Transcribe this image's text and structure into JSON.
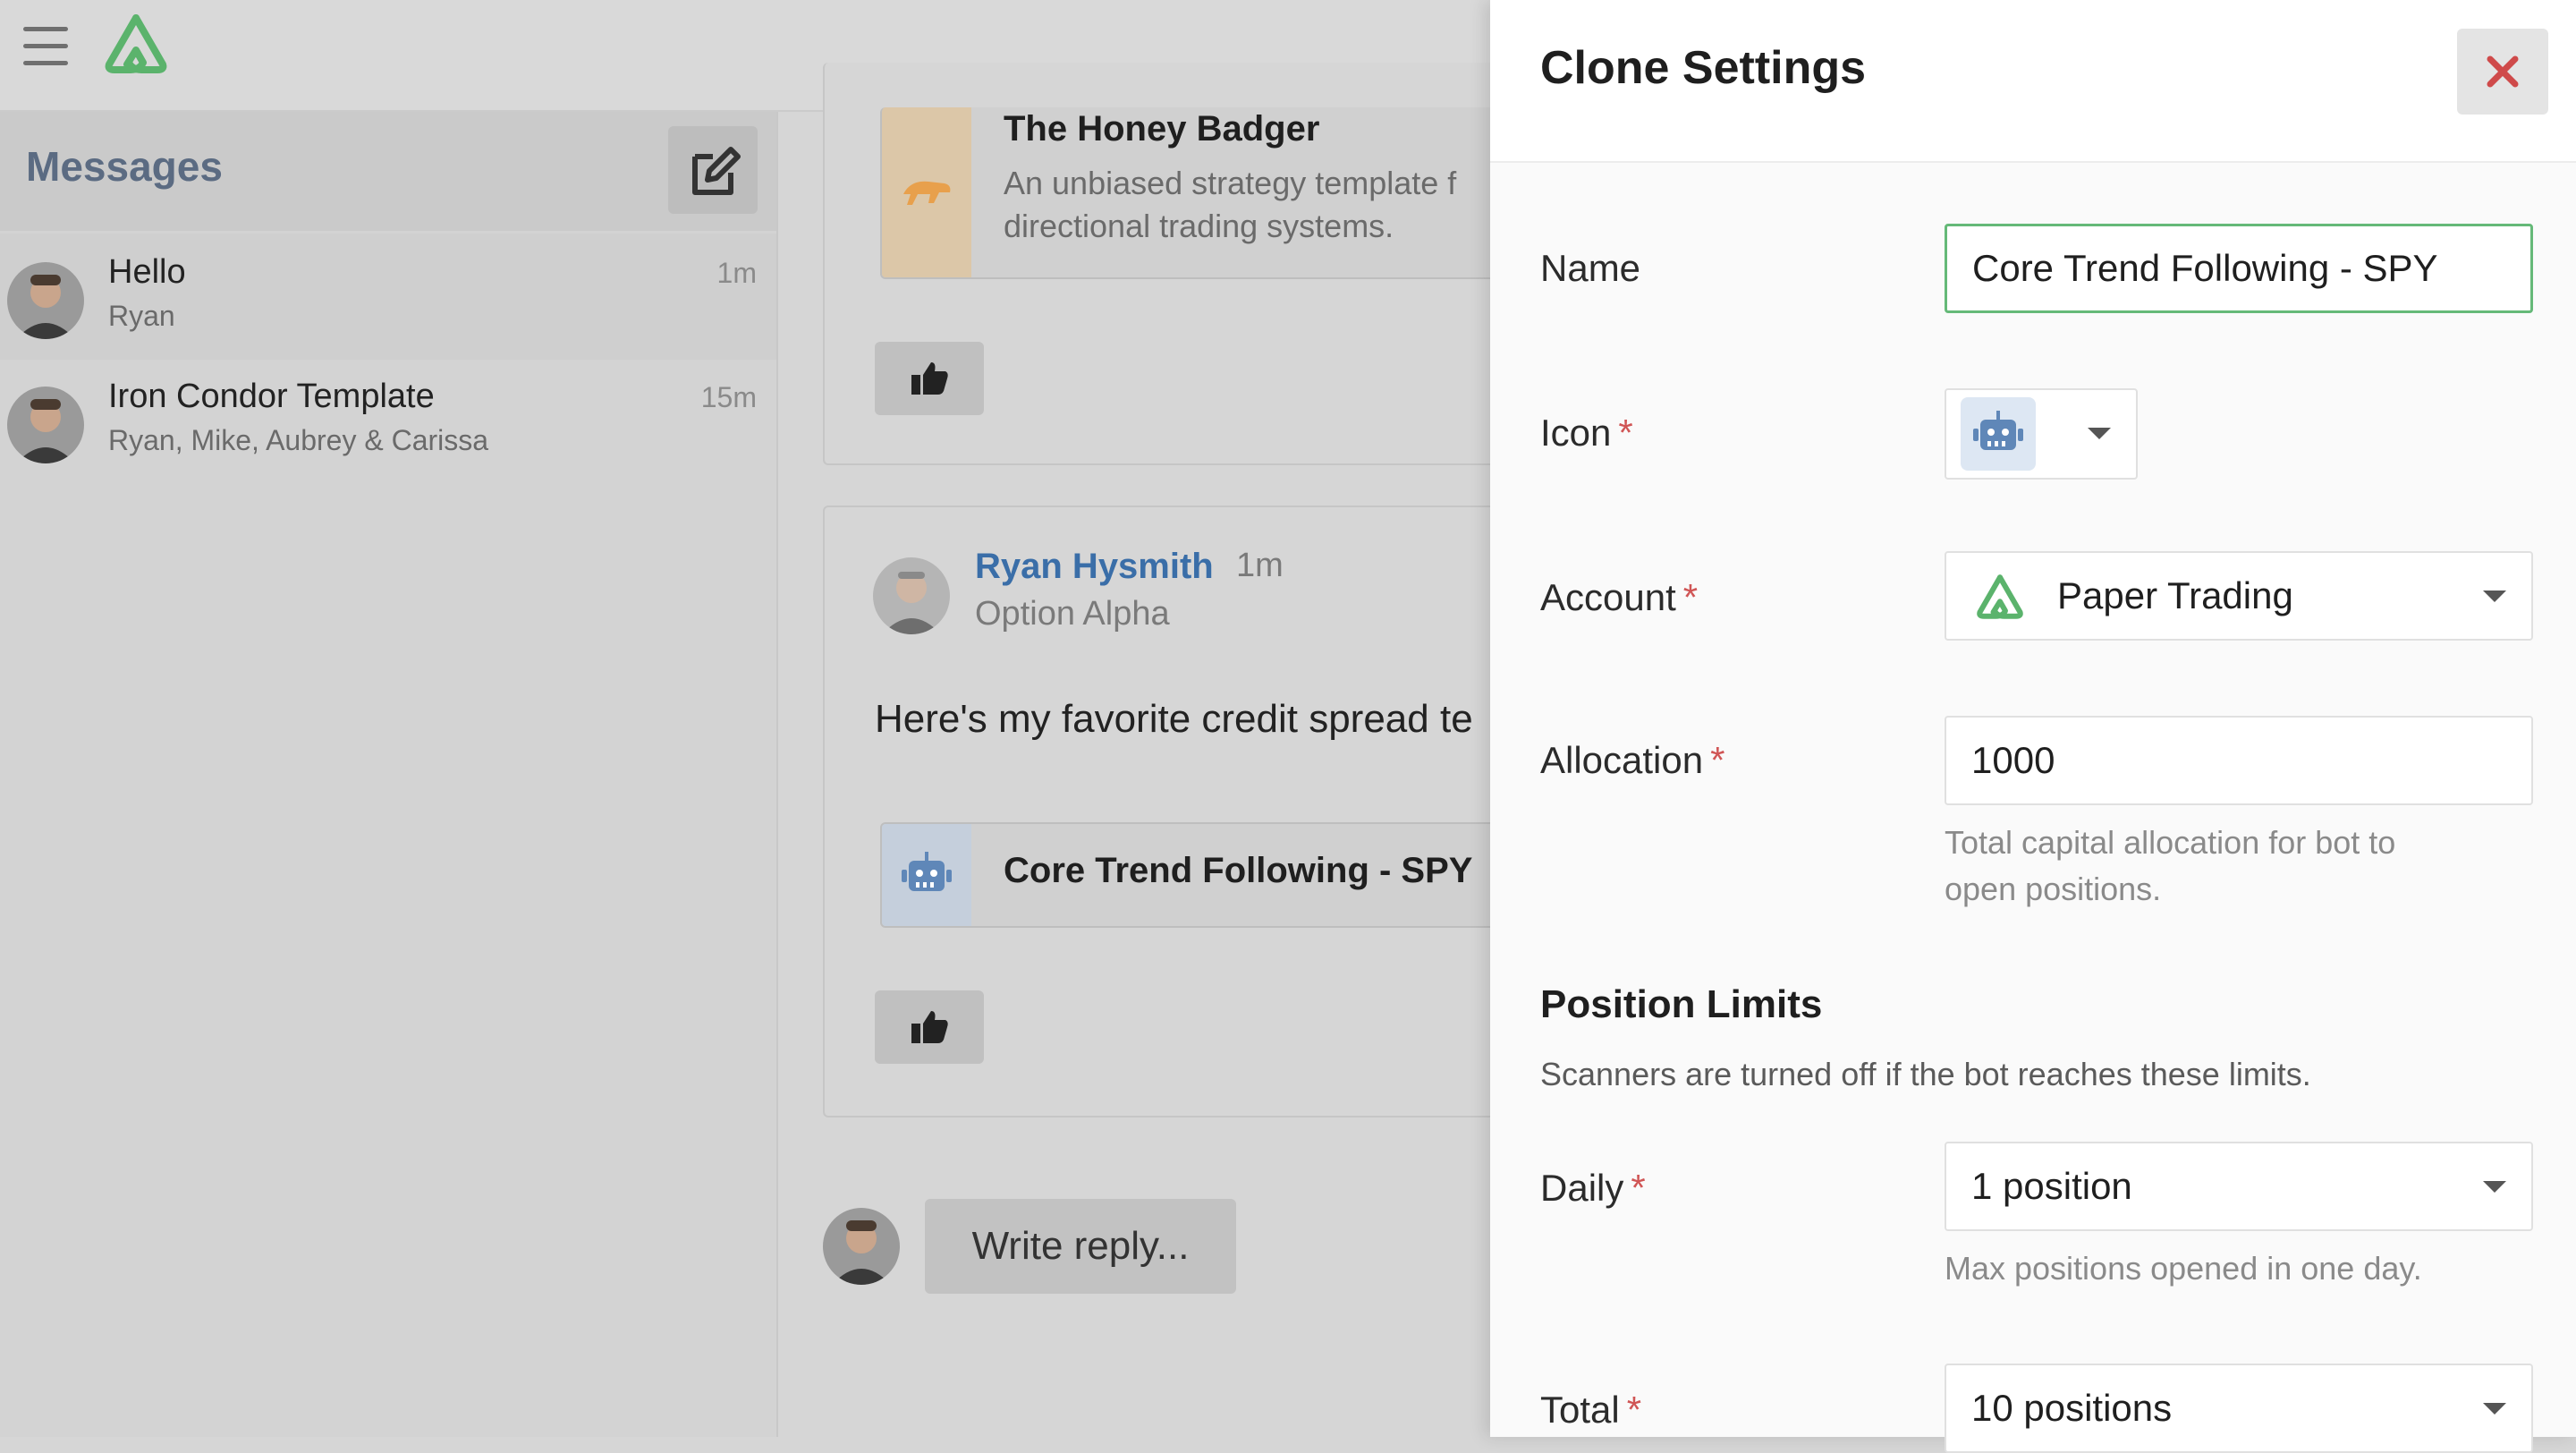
{
  "topbar": {
    "menu_icon": "hamburger-menu-icon",
    "logo_icon": "option-alpha-logo-icon"
  },
  "sidebar": {
    "title": "Messages",
    "compose_icon": "compose-icon",
    "conversations": [
      {
        "name": "Hello",
        "participants": "Ryan",
        "time": "1m"
      },
      {
        "name": "Iron Condor Template",
        "participants": "Ryan, Mike, Aubrey & Carissa",
        "time": "15m"
      }
    ]
  },
  "feed": {
    "post1": {
      "attachment_title": "The Honey Badger",
      "attachment_desc_line1": "An unbiased strategy template f",
      "attachment_desc_line2": "directional trading systems."
    },
    "post2": {
      "author": "Ryan Hysmith",
      "time": "1m",
      "org": "Option Alpha",
      "text": "Here's my favorite credit spread te",
      "attachment_title": "Core Trend Following - SPY"
    },
    "reply_placeholder": "Write reply..."
  },
  "drawer": {
    "title": "Clone Settings",
    "close_icon": "close-icon",
    "name_label": "Name",
    "name_value": "Core Trend Following - SPY",
    "icon_label": "Icon",
    "icon_value": "robot-icon",
    "account_label": "Account",
    "account_value": "Paper Trading",
    "allocation_label": "Allocation",
    "allocation_value": "1000",
    "allocation_help_line1": "Total capital allocation for bot to",
    "allocation_help_line2": "open positions.",
    "limits_title": "Position Limits",
    "limits_sub": "Scanners are turned off if the bot reaches these limits.",
    "daily_label": "Daily",
    "daily_value": "1 position",
    "daily_help": "Max positions opened in one day.",
    "total_label": "Total",
    "total_value": "10 positions",
    "required_mark": "*"
  },
  "colors": {
    "accent_green": "#5bb36c",
    "link_blue": "#3a6ea8",
    "close_red": "#cf4a4a",
    "required_red": "#d05555"
  }
}
